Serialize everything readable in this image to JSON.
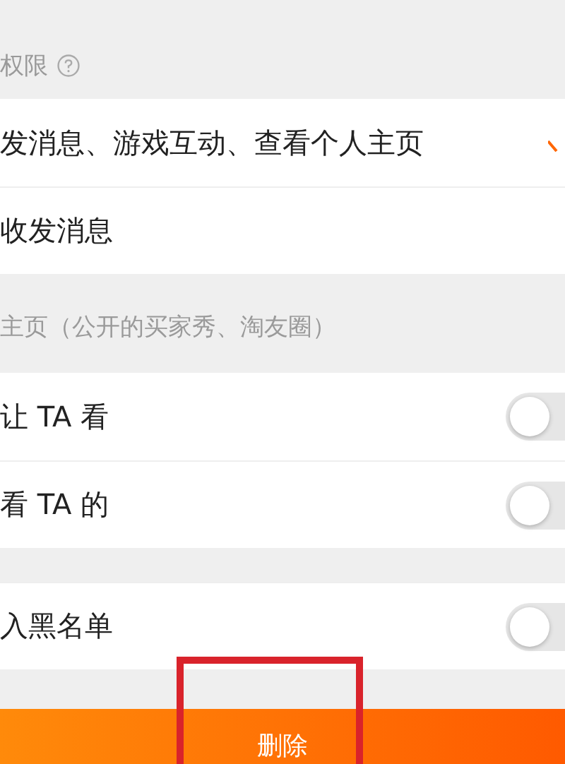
{
  "permission_section": {
    "title": "权限"
  },
  "permission_options": [
    {
      "label": "发消息、游戏互动、查看个人主页",
      "selected": true
    },
    {
      "label": "收发消息",
      "selected": false
    }
  ],
  "homepage_section": {
    "title": "主页（公开的买家秀、淘友圈）"
  },
  "homepage_toggles": [
    {
      "label": "让 TA 看",
      "checked": false
    },
    {
      "label": "看 TA 的",
      "checked": false
    }
  ],
  "blacklist_toggle": {
    "label": "入黑名单",
    "checked": false
  },
  "delete_button": {
    "label": "删除"
  }
}
